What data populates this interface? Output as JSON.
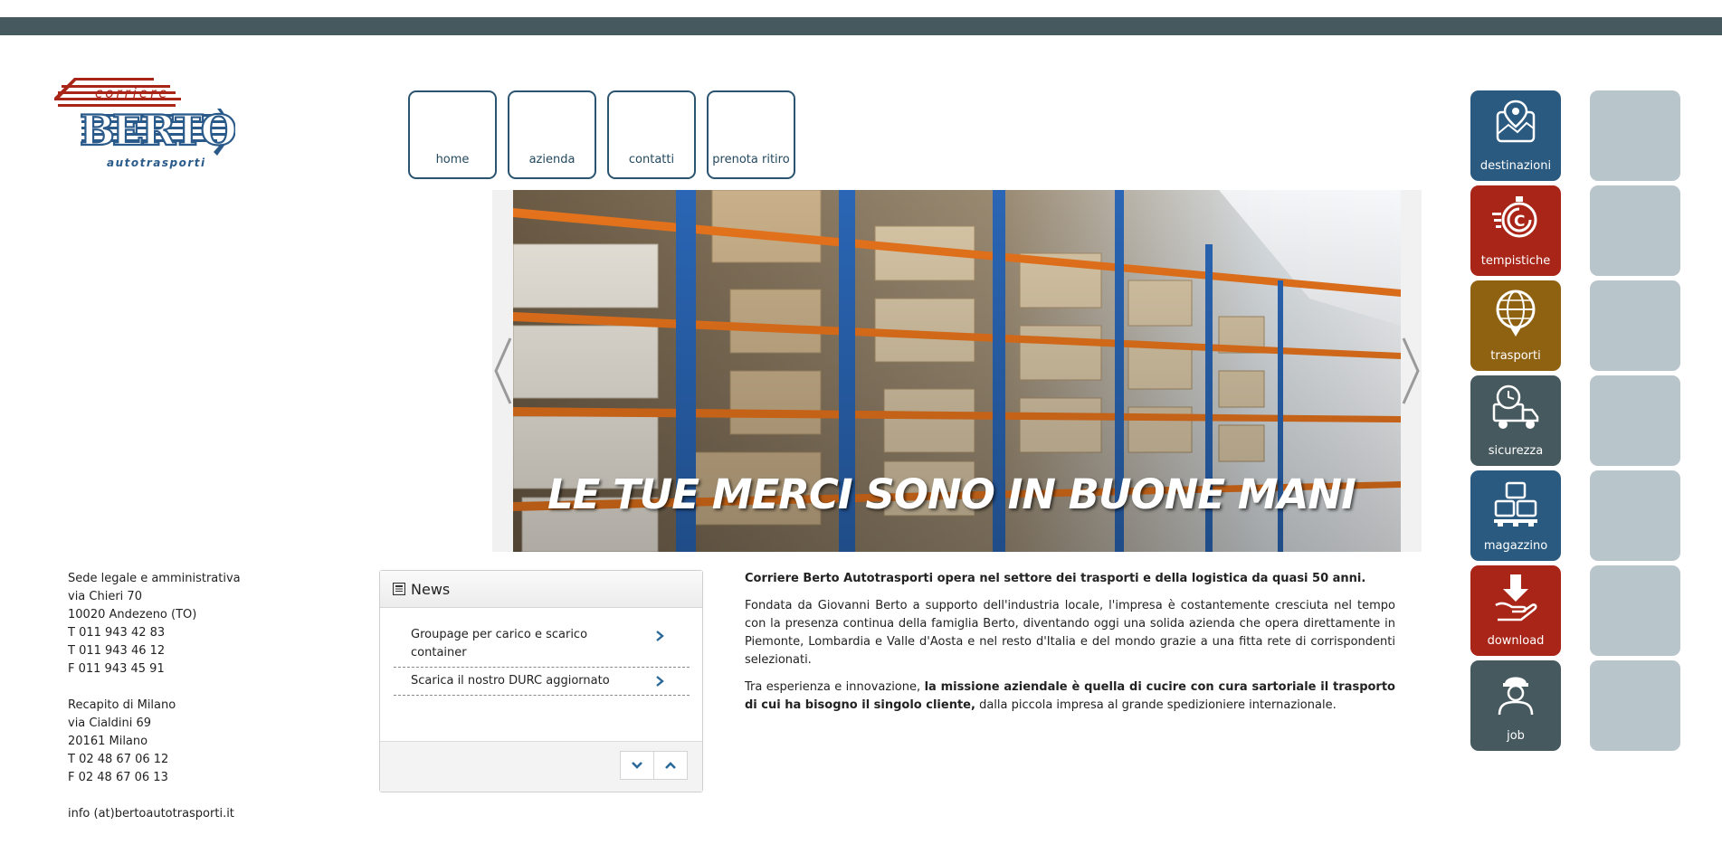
{
  "logo": {
    "top_text": "corriere",
    "brand": "BERTO",
    "bottom_text": "autotrasporti"
  },
  "nav": {
    "items": [
      {
        "label": "home"
      },
      {
        "label": "azienda"
      },
      {
        "label": "contatti"
      },
      {
        "label": "prenota ritiro"
      }
    ]
  },
  "slider": {
    "caption": "LE TUE MERCI SONO IN BUONE MANI"
  },
  "address": {
    "legal": [
      "Sede legale e amministrativa",
      "via Chieri 70",
      "10020 Andezeno (TO)",
      "T 011 943 42 83",
      "T 011 943 46 12",
      "F 011 943 45 91"
    ],
    "milan": [
      "Recapito di Milano",
      "via Cialdini 69",
      "20161 Milano",
      "T 02 48 67 06 12",
      "F 02 48 67 06 13"
    ],
    "email": "info (at)bertoautotrasporti.it"
  },
  "news": {
    "title": "News",
    "items": [
      {
        "text": "Groupage per carico e scarico container"
      },
      {
        "text": "Scarica il nostro DURC aggiornato"
      }
    ]
  },
  "about": {
    "intro": "Corriere Berto Autotrasporti opera nel settore dei trasporti e della logistica da quasi 50 anni.",
    "paragraph": "Fondata da Giovanni Berto a supporto dell'industria locale, l'impresa è costantemente cresciuta nel tempo con la presenza continua della famiglia Berto, diventando oggi una solida azienda che opera direttamente in Piemonte, Lombardia e Valle d'Aosta e nel resto d'Italia e del mondo grazie a una fitta rete di corrispondenti selezionati.",
    "mission_lead": "Tra esperienza e innovazione, ",
    "mission_bold": "la missione aziendale è quella di cucire con cura sartoriale il trasporto di cui ha bisogno il singolo cliente,",
    "mission_tail": " dalla piccola impresa al grande spedizioniere internazionale."
  },
  "tiles": [
    {
      "label": "destinazioni",
      "icon": "map-pin-icon",
      "color": "#2a5a80"
    },
    {
      "label": "tempistiche",
      "icon": "stopwatch-icon",
      "color": "#a82518"
    },
    {
      "label": "trasporti",
      "icon": "globe-icon",
      "color": "#8f6212"
    },
    {
      "label": "sicurezza",
      "icon": "truck-icon",
      "color": "#46595e"
    },
    {
      "label": "magazzino",
      "icon": "pallet-icon",
      "color": "#2a5a80"
    },
    {
      "label": "download",
      "icon": "download-hand-icon",
      "color": "#a82518"
    },
    {
      "label": "job",
      "icon": "worker-icon",
      "color": "#46595e"
    }
  ],
  "colors": {
    "topbar": "#46595e",
    "nav_border": "#2a5470",
    "ghost_tile": "#b8c5ca",
    "logo_red": "#a82518",
    "logo_blue": "#2a5a8a"
  }
}
